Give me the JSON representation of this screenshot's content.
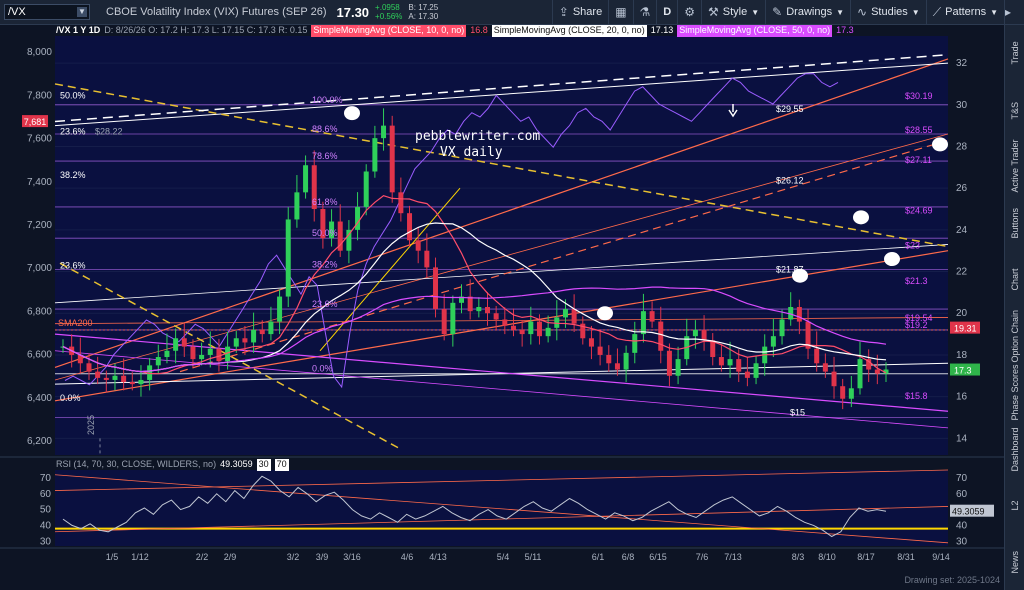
{
  "toolbar": {
    "symbol": "/VX",
    "description": "CBOE Volatility Index (VIX) Futures (SEP 26)",
    "last": "17.30",
    "change": "+.0958",
    "change_pct": "+0.56%",
    "bid": "B: 17.25",
    "ask": "A: 17.30",
    "share_label": "Share",
    "period_label": "D",
    "style_label": "Style",
    "drawings_label": "Drawings",
    "studies_label": "Studies",
    "patterns_label": "Patterns"
  },
  "legend": {
    "symbol_tf": "/VX 1 Y 1D",
    "ohlc": "D: 8/26/26   O: 17.2   H: 17.3   L: 17.15   C: 17.3   R: 0.15",
    "sma10_label": "SimpleMovingAvg (CLOSE, 10, 0, no)",
    "sma10_value": "16.8",
    "sma20_label": "SimpleMovingAvg (CLOSE, 20, 0, no)",
    "sma20_value": "17.13",
    "sma50_label": "SimpleMovingAvg (CLOSE, 50, 0, no)",
    "sma50_value": "17.3",
    "colors": {
      "sma10": "#ff4d6a",
      "sma20": "#ffffff",
      "sma50": "#d94cff"
    }
  },
  "rsi_legend": {
    "label": "RSI (14, 70, 30, CLOSE, WILDERS, no)",
    "value": "49.3059",
    "over": "30",
    "under": "70"
  },
  "right_rail": [
    "Trade",
    "T&S",
    "Active Trader",
    "Buttons",
    "Chart",
    "Option Chain",
    "Phase Scores",
    "Dashboard",
    "L2",
    "News"
  ],
  "footer": {
    "drawing_set": "Drawing set: 2025-1024"
  },
  "chart_data": {
    "type": "candlestick",
    "watermark": [
      "pebblewriter.com",
      "VX daily"
    ],
    "x_ticks": [
      "1/5",
      "1/12",
      "2/2",
      "2/9",
      "3/2",
      "3/9",
      "3/16",
      "4/6",
      "4/13",
      "5/4",
      "5/11",
      "6/1",
      "6/8",
      "6/15",
      "7/6",
      "7/13",
      "8/3",
      "8/10",
      "8/17",
      "8/31",
      "9/14"
    ],
    "year_label": "2025",
    "right_axis": {
      "ticks": [
        14,
        16,
        18,
        20,
        22,
        24,
        26,
        28,
        30,
        32
      ],
      "range": [
        13.2,
        33.3
      ]
    },
    "left_axis": {
      "ticks": [
        "6,200",
        "6,400",
        "6,600",
        "6,800",
        "7,000",
        "7,200",
        "7,400",
        "7,600",
        "7,800",
        "8,000"
      ],
      "range": [
        6135,
        8075
      ],
      "current": "7,681"
    },
    "current_price": "17.3",
    "price_tags": [
      {
        "label": "19.31",
        "color": "#e0344a"
      },
      {
        "label": "17.3",
        "color": "#2fb44a"
      }
    ],
    "fib_labels": [
      {
        "text": "100.0%",
        "value": 30.0
      },
      {
        "text": "88.6%",
        "value": 28.6
      },
      {
        "text": "78.6%",
        "value": 27.3
      },
      {
        "text": "61.8%",
        "value": 25.1
      },
      {
        "text": "50.0%",
        "value": 23.6
      },
      {
        "text": "38.2%",
        "value": 22.1
      },
      {
        "text": "23.6%",
        "value": 20.2
      },
      {
        "text": "0.0%",
        "value": 17.1
      }
    ],
    "left_fib_labels": [
      {
        "text": "50.0%",
        "spx": 7800
      },
      {
        "text": "23.6%",
        "spx": 7632
      },
      {
        "text": "38.2%",
        "spx": 7432
      },
      {
        "text": "23.6%",
        "spx": 7012
      },
      {
        "text": "0.0%",
        "spx": 6400
      }
    ],
    "left_note": "$28.22",
    "level_labels": [
      {
        "text": "$30.19",
        "value": 30.19
      },
      {
        "text": "$29.55",
        "value": 29.55
      },
      {
        "text": "$28.55",
        "value": 28.55
      },
      {
        "text": "$27.11",
        "value": 27.11
      },
      {
        "text": "$26.12",
        "value": 26.12
      },
      {
        "text": "$24.69",
        "value": 24.69
      },
      {
        "text": "$23",
        "value": 23.0
      },
      {
        "text": "$21.87",
        "value": 21.87
      },
      {
        "text": "$21.3",
        "value": 21.3
      },
      {
        "text": "$19.54",
        "value": 19.54
      },
      {
        "text": "$19.2",
        "value": 19.2
      },
      {
        "text": "$15.8",
        "value": 15.8
      },
      {
        "text": "$15",
        "value": 15.0
      }
    ],
    "sma200_label": "SMA200",
    "series_close": [
      18.4,
      18.0,
      17.6,
      17.2,
      16.9,
      16.8,
      17.0,
      16.7,
      16.6,
      16.8,
      17.5,
      17.9,
      18.2,
      18.8,
      18.4,
      17.8,
      18.0,
      18.3,
      17.7,
      18.4,
      18.8,
      18.6,
      19.2,
      19.0,
      19.6,
      20.8,
      24.5,
      25.8,
      27.1,
      25.0,
      23.6,
      24.4,
      23.0,
      24.0,
      25.1,
      26.8,
      28.4,
      29.0,
      25.8,
      24.8,
      23.5,
      23.0,
      22.2,
      20.2,
      19.0,
      20.5,
      20.8,
      20.1,
      20.3,
      20.0,
      19.7,
      19.4,
      19.2,
      19.0,
      19.6,
      18.9,
      19.3,
      19.8,
      20.2,
      19.5,
      18.8,
      18.4,
      18.0,
      17.6,
      17.3,
      18.1,
      19.0,
      20.1,
      19.6,
      18.2,
      17.0,
      17.8,
      18.9,
      19.2,
      18.7,
      17.9,
      17.5,
      17.8,
      17.2,
      16.9,
      17.6,
      18.4,
      18.9,
      19.7,
      20.3,
      19.6,
      18.3,
      17.6,
      17.2,
      16.5,
      15.9,
      16.4,
      17.8,
      17.3,
      17.1,
      17.3
    ],
    "rsi": {
      "axis_ticks": [
        30,
        40,
        50,
        60,
        70
      ],
      "range": [
        27,
        75
      ],
      "current": "49.3059",
      "values": [
        44,
        40,
        38,
        41,
        37,
        36,
        39,
        42,
        48,
        51,
        47,
        53,
        56,
        50,
        52,
        58,
        54,
        60,
        55,
        62,
        57,
        65,
        71,
        68,
        62,
        58,
        64,
        60,
        55,
        59,
        61,
        56,
        50,
        46,
        44,
        48,
        45,
        42,
        47,
        44,
        46,
        49,
        52,
        48,
        45,
        43,
        47,
        50,
        46,
        44,
        48,
        52,
        55,
        51,
        49,
        53,
        57,
        54,
        50,
        47,
        44,
        48,
        46,
        43,
        45,
        49,
        52,
        55,
        50,
        47,
        45,
        49,
        53,
        56,
        58,
        54,
        50,
        46,
        48,
        52,
        49,
        45,
        42,
        40,
        37,
        33,
        36,
        45,
        51,
        49,
        50,
        49
      ]
    },
    "spx_series": [
      6480,
      6500,
      6480,
      6460,
      6500,
      6540,
      6600,
      6640,
      6680,
      6720,
      6760,
      6740,
      6700,
      6680,
      6660,
      6700,
      6740,
      6720,
      6680,
      6640,
      6700,
      6760,
      6820,
      6880,
      6940,
      7020,
      7060,
      7000,
      6940,
      6880,
      6960,
      6920,
      6700,
      6500,
      6450,
      6700,
      6900,
      7020,
      7100,
      7160,
      7220,
      7300,
      7380,
      7460,
      7500,
      7540,
      7600,
      7640,
      7620,
      7680,
      7720,
      7700,
      7740,
      7800,
      7760,
      7720,
      7680,
      7700,
      7640,
      7600,
      7560,
      7620,
      7660,
      7720,
      7740,
      7700,
      7680,
      7640,
      7700,
      7760,
      7820,
      7840,
      7800,
      7760,
      7740,
      7720,
      7700,
      7680,
      7720,
      7760,
      7800,
      7840,
      7880,
      7860,
      7820,
      7800,
      7780,
      7760,
      7800,
      7840,
      7880,
      7900,
      7900,
      7860,
      7840,
      7860
    ]
  }
}
